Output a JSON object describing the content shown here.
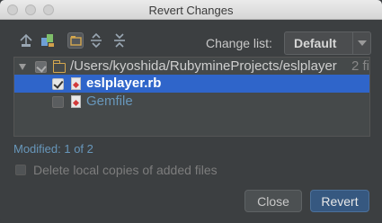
{
  "window": {
    "title": "Revert Changes"
  },
  "toolbar": {
    "icons": [
      "collapse-icon",
      "diff-icon",
      "group-by-directory-icon",
      "expand-all-icon",
      "collapse-all-icon"
    ],
    "changelist_label": "Change list:",
    "changelist_value": "Default"
  },
  "tree": {
    "root": {
      "path": "/Users/kyoshida/RubymineProjects/eslplayer",
      "extra": "2 fi",
      "checked": "partial"
    },
    "files": [
      {
        "name": "eslplayer.rb",
        "checked": true,
        "selected": true
      },
      {
        "name": "Gemfile",
        "checked": false,
        "selected": false
      }
    ]
  },
  "status": {
    "modified": "Modified: 1 of 2"
  },
  "options": {
    "delete_local_label": "Delete local copies of added files",
    "delete_local_checked": false
  },
  "buttons": {
    "close": "Close",
    "revert": "Revert"
  },
  "colors": {
    "selection": "#2f65ca",
    "link_blue": "#6897bb",
    "primary_button": "#365880"
  }
}
